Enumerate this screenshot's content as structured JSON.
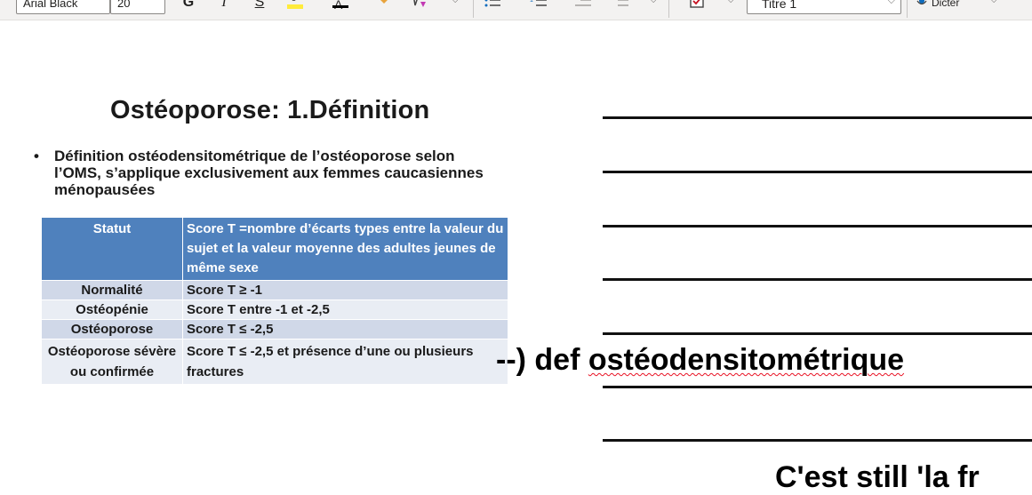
{
  "toolbar": {
    "font_name": "Arial Black",
    "font_size": "20",
    "bold": "G",
    "italic": "I",
    "underline": "S",
    "highlight_color": "#ffeb3b",
    "font_color_letter": "A",
    "style_value": "Titre 1",
    "dictate_label": "Dicter"
  },
  "slide": {
    "title": "Ostéoporose: 1.Définition",
    "bullet_symbol": "•",
    "bullet_text": "Définition ostéodensitométrique de l’ostéoporose selon l’OMS, s’applique exclusivement aux femmes caucasiennes ménopausées",
    "table": {
      "headers": [
        "Statut",
        "Score T =nombre d’écarts types entre la valeur du sujet et la valeur moyenne des adultes jeunes de même sexe"
      ],
      "rows": [
        [
          "Normalité",
          "Score T ≥ -1"
        ],
        [
          "Ostéopénie",
          "Score T entre -1 et -2,5"
        ],
        [
          "Ostéoporose",
          "Score T ≤ -2,5"
        ],
        [
          "Ostéoporose sévère ou confirmée",
          "Score T ≤ -2,5 et présence d’une ou plusieurs fractures"
        ]
      ]
    }
  },
  "notes": {
    "prefix": "--) def ",
    "term": "ostéodensitométrique",
    "bottom_partial": "C'est still 'la fr"
  }
}
